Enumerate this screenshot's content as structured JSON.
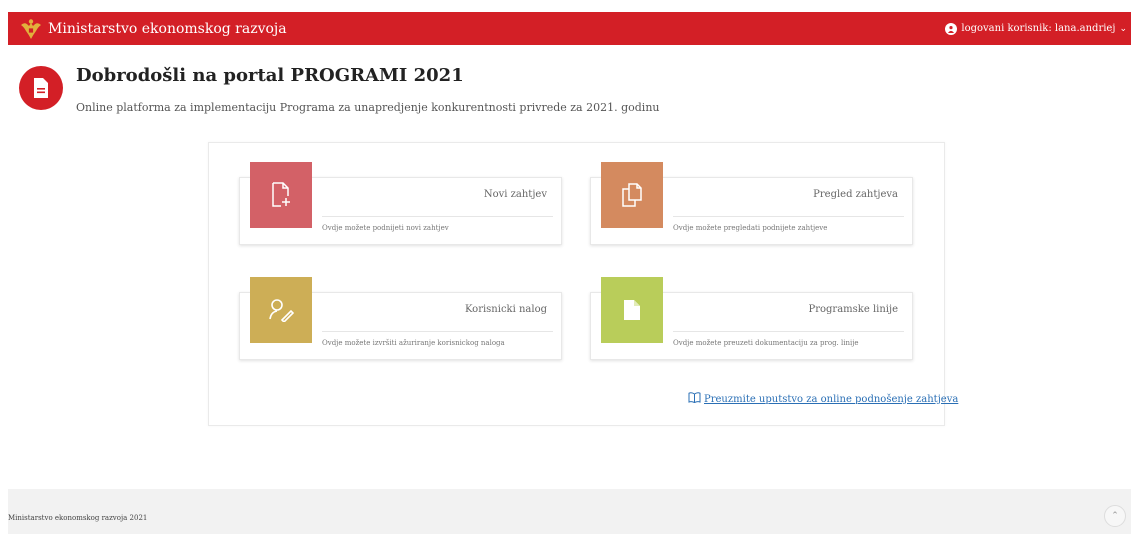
{
  "header": {
    "brand": "Ministarstvo ekonomskog razvoja",
    "user_label": "logovani korisnik: lana.andriej",
    "accent_color": "#d31f26"
  },
  "intro": {
    "title": "Dobrodošli na portal PROGRAMI 2021",
    "subtitle": "Online platforma za implementaciju Programa za unapredjenje konkurentnosti privrede za 2021. godinu"
  },
  "cards": [
    {
      "title": "Novi zahtjev",
      "desc": "Ovdje možete podnijeti novi zahtjev",
      "color": "#d36167",
      "icon": "file-plus-icon"
    },
    {
      "title": "Pregled zahtjeva",
      "desc": "Ovdje možete pregledati podnijete zahtjeve",
      "color": "#d48a5f",
      "icon": "files-copy-icon"
    },
    {
      "title": "Korisnicki nalog",
      "desc": "Ovdje možete izvršiti ažuriranje korisnickog naloga",
      "color": "#cdae56",
      "icon": "user-edit-icon"
    },
    {
      "title": "Programske linije",
      "desc": "Ovdje možete preuzeti dokumentaciju za prog. linije",
      "color": "#b9cd5a",
      "icon": "document-icon"
    }
  ],
  "manual_link": "Preuzmite uputstvo za online podnošenje zahtjeva",
  "footer": {
    "text": "Ministarstvo ekonomskog razvoja 2021"
  }
}
